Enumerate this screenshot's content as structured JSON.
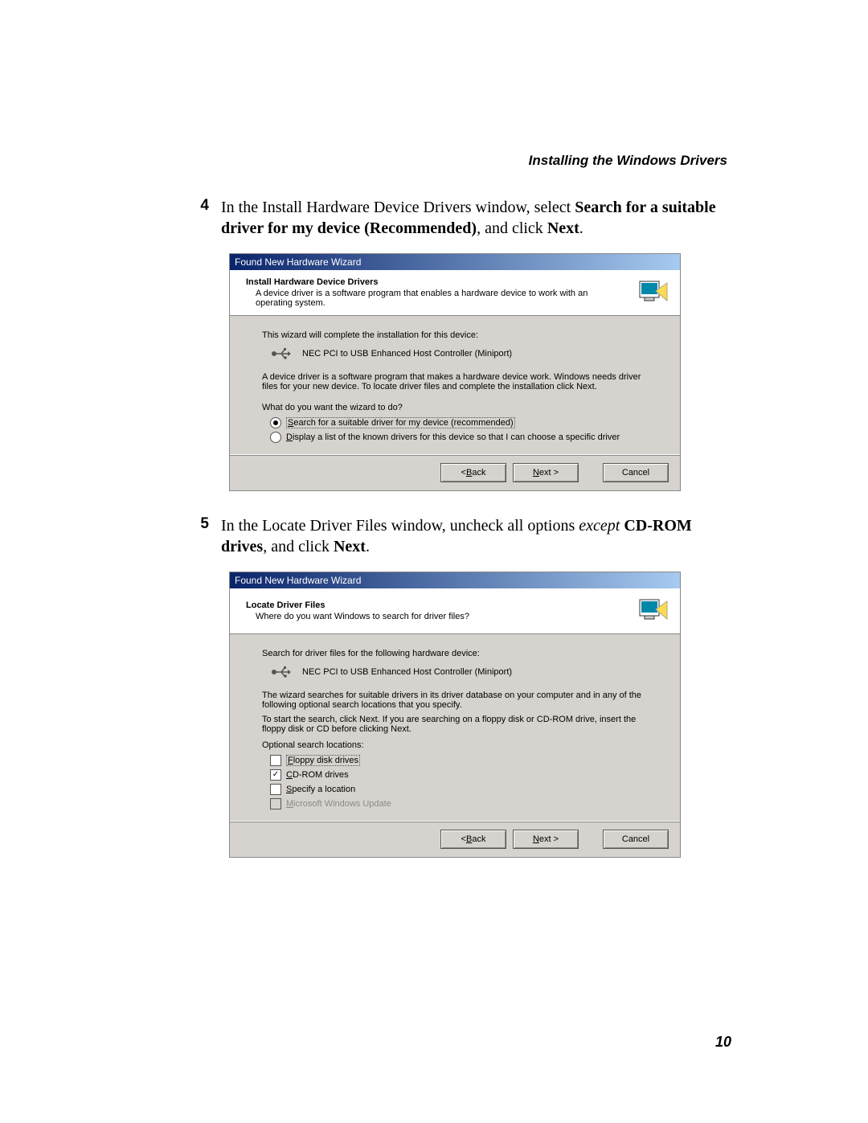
{
  "header": {
    "section": "Installing the Windows Drivers"
  },
  "page_number": "10",
  "steps": {
    "s4": {
      "num": "4",
      "pre": "In the Install Hardware Device Drivers window, select ",
      "bold1": "Search for a suitable driver for my device (Recommended)",
      "mid": ", and click ",
      "bold2": "Next",
      "post": "."
    },
    "s5": {
      "num": "5",
      "pre": "In the Locate Driver Files window, uncheck all options ",
      "ital": "except",
      "mid": " ",
      "bold1": "CD-ROM drives",
      "mid2": ", and click ",
      "bold2": "Next",
      "post": "."
    }
  },
  "wizard1": {
    "titlebar": "Found New Hardware Wizard",
    "header_title": "Install Hardware Device Drivers",
    "header_sub": "A device driver is a software program that enables a hardware device to work with an operating system.",
    "body": {
      "intro": "This wizard will complete the installation for this device:",
      "device": "NEC PCI to USB Enhanced Host Controller (Miniport)",
      "para": "A device driver is a software program that makes a hardware device work. Windows needs driver files for your new device. To locate driver files and complete the installation click Next.",
      "question": "What do you want the wizard to do?",
      "opt1_pre": "S",
      "opt1_rest": "earch for a suitable driver for my device (recommended)",
      "opt2_pre": "D",
      "opt2_rest": "isplay a list of the known drivers for this device so that I can choose a specific driver"
    },
    "buttons": {
      "back_pre": "< ",
      "back_u": "B",
      "back_rest": "ack",
      "next_u": "N",
      "next_rest": "ext >",
      "cancel": "Cancel"
    }
  },
  "wizard2": {
    "titlebar": "Found New Hardware Wizard",
    "header_title": "Locate Driver Files",
    "header_sub": "Where do you want Windows to search for driver files?",
    "body": {
      "intro": "Search for driver files for the following hardware device:",
      "device": "NEC PCI to USB Enhanced Host Controller (Miniport)",
      "para1": "The wizard searches for suitable drivers in its driver database on your computer and in any of the following optional search locations that you specify.",
      "para2": "To start the search, click Next. If you are searching on a floppy disk or CD-ROM drive, insert the floppy disk or CD before clicking Next.",
      "locations_label": "Optional search locations:",
      "opt1_u": "F",
      "opt1_rest": "loppy disk drives",
      "opt2_u": "C",
      "opt2_rest": "D-ROM drives",
      "opt3_u": "S",
      "opt3_rest": "pecify a location",
      "opt4_u": "M",
      "opt4_rest": "icrosoft Windows Update"
    },
    "buttons": {
      "back_pre": "< ",
      "back_u": "B",
      "back_rest": "ack",
      "next_u": "N",
      "next_rest": "ext >",
      "cancel": "Cancel"
    }
  }
}
